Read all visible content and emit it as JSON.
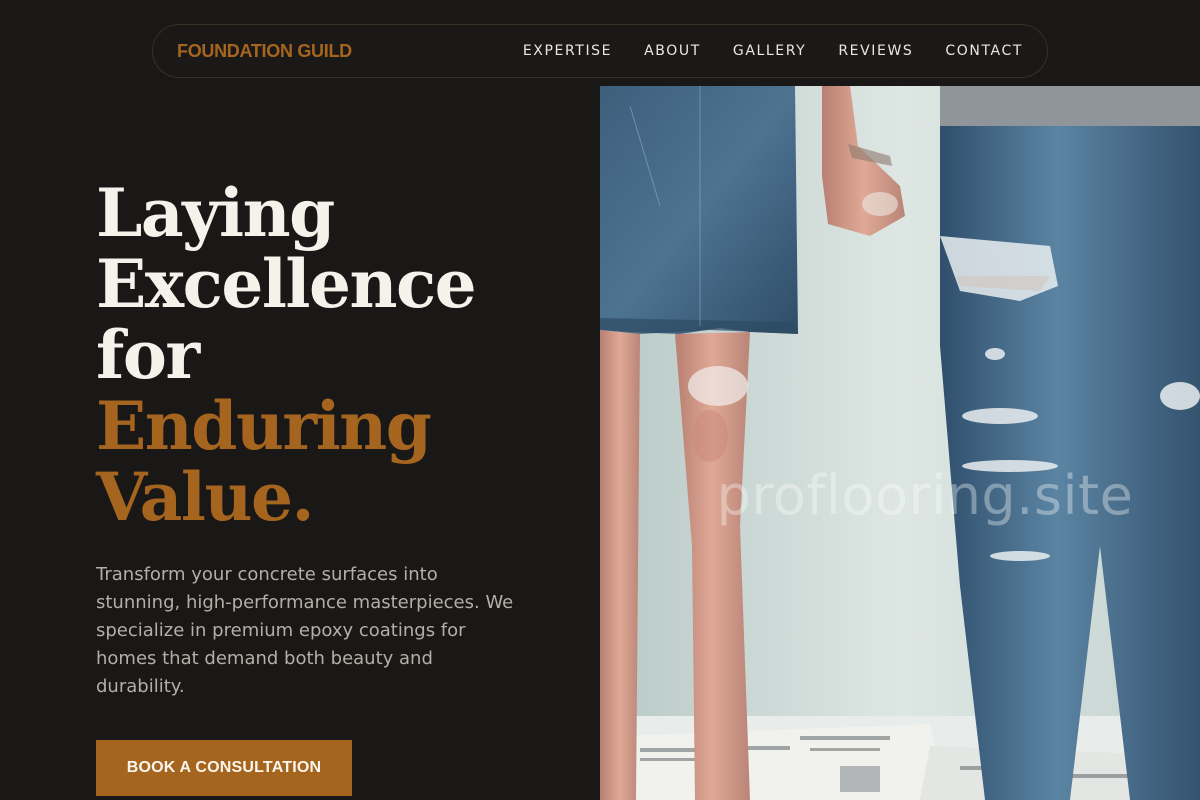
{
  "brand": "FOUNDATION GUILD",
  "nav": {
    "items": [
      {
        "label": "EXPERTISE"
      },
      {
        "label": "ABOUT"
      },
      {
        "label": "GALLERY"
      },
      {
        "label": "REVIEWS"
      },
      {
        "label": "CONTACT"
      }
    ]
  },
  "hero": {
    "title_lines": [
      "Laying",
      "Excellence",
      "for"
    ],
    "title_accent_lines": [
      "Enduring",
      "Value."
    ],
    "description": "Transform your concrete surfaces into stunning, high-performance masterpieces. We specialize in premium epoxy coatings for homes that demand both beauty and durability.",
    "cta_label": "BOOK A CONSULTATION",
    "image_watermark": "proflooring.site"
  },
  "colors": {
    "background": "#1a1817",
    "accent": "#a6651f",
    "text": "#f5f2ec",
    "muted": "#b3aea6"
  }
}
